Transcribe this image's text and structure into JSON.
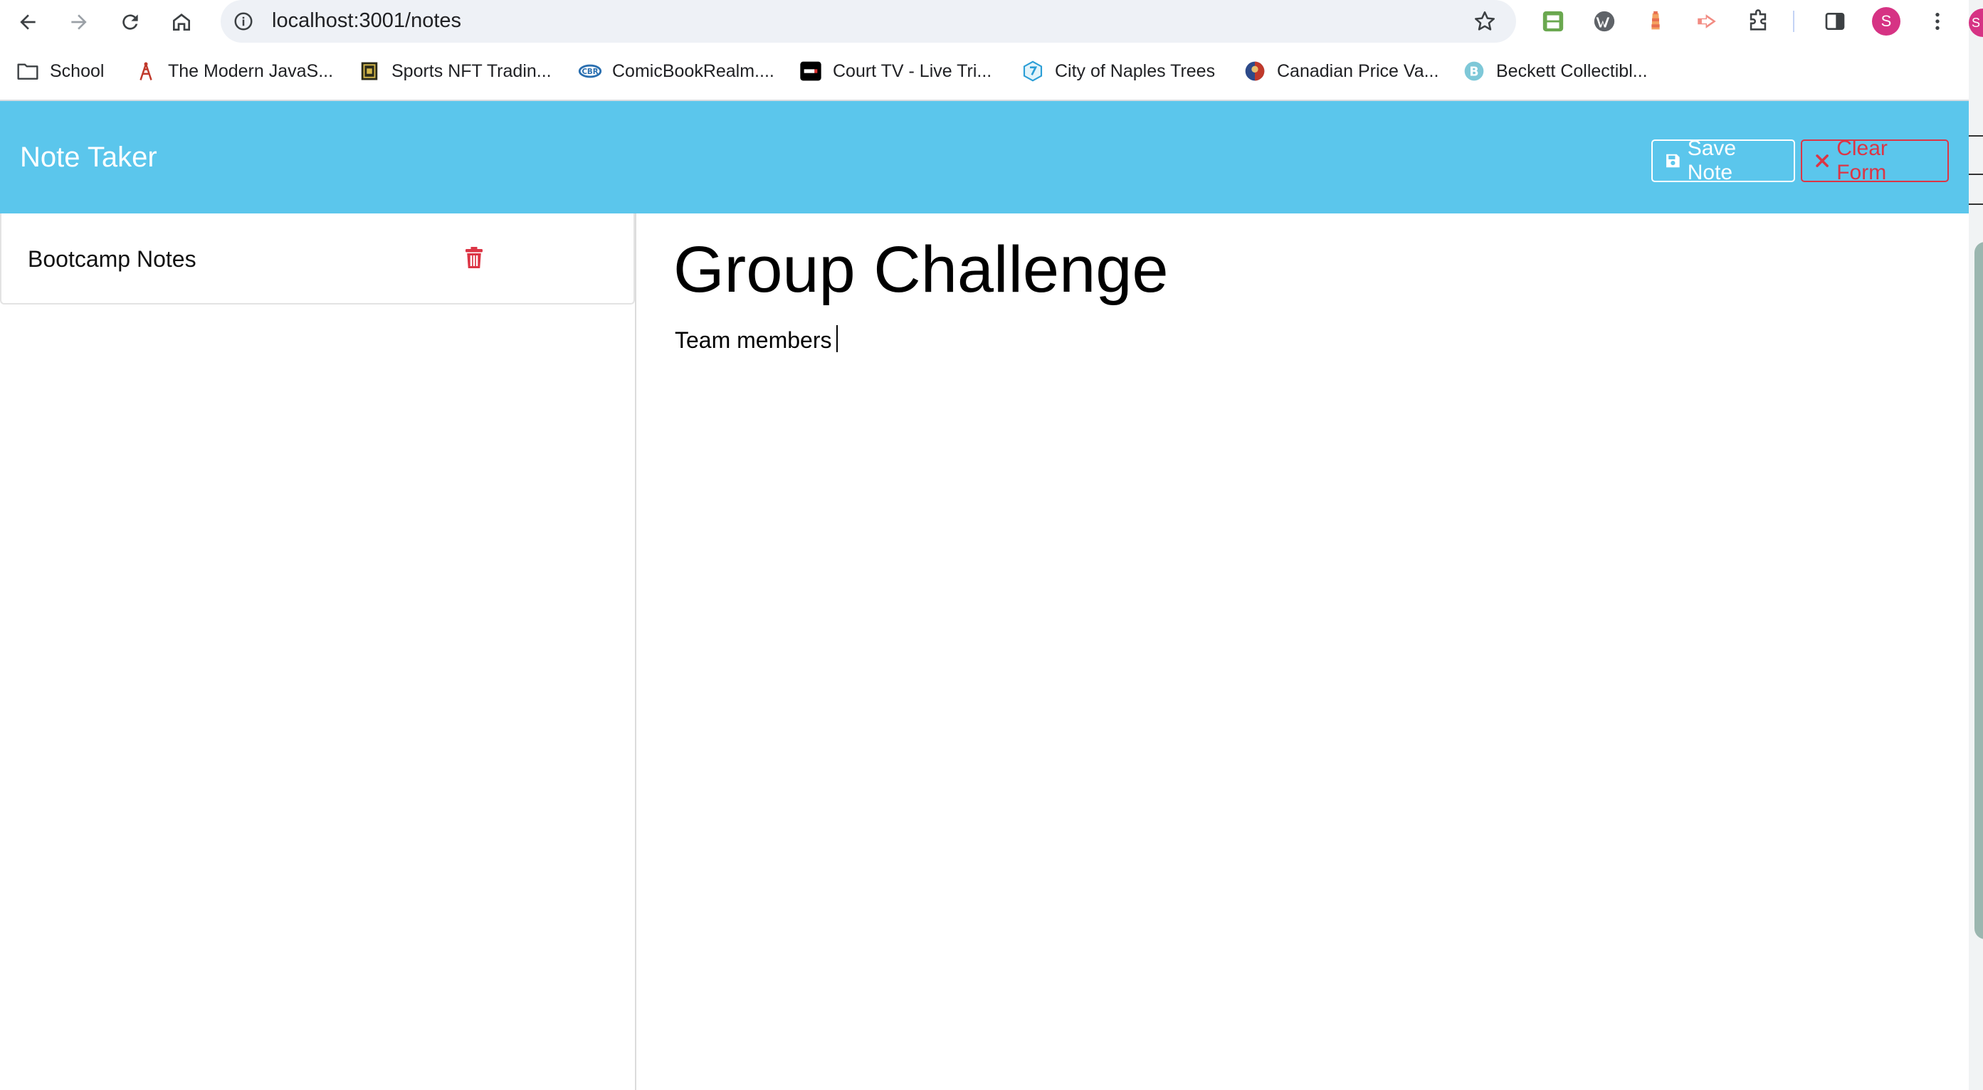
{
  "browser": {
    "url": "localhost:3001/notes",
    "profile_initial": "S",
    "bookmarks": [
      "School",
      "The Modern JavaS...",
      "Sports NFT Tradin...",
      "ComicBookRealm....",
      "Court TV - Live Tri...",
      "City of Naples Trees",
      "Canadian Price Va...",
      "Beckett Collectibl..."
    ],
    "icons": {
      "back": "arrow-left-icon",
      "forward": "arrow-right-icon",
      "reload": "reload-icon",
      "home": "home-icon",
      "info": "info-icon",
      "bookmark_star": "star-icon",
      "extensions": [
        "printer-extension-icon",
        "w-extension-icon",
        "lighthouse-extension-icon",
        "arrow-extension-icon",
        "puzzle-icon",
        "side-panel-icon",
        "kebab-menu-icon"
      ]
    }
  },
  "app": {
    "brand": "Note Taker",
    "save_label": "Save Note",
    "clear_label": "Clear Form",
    "notes": [
      {
        "title": "Bootcamp Notes"
      }
    ],
    "active_note": {
      "title": "Group Challenge",
      "text": "Team members"
    },
    "colors": {
      "navbar": "#5bc6ec",
      "danger": "#dc3545",
      "profile": "#d63384"
    }
  },
  "edge_window": {
    "tab_initial": "S"
  }
}
